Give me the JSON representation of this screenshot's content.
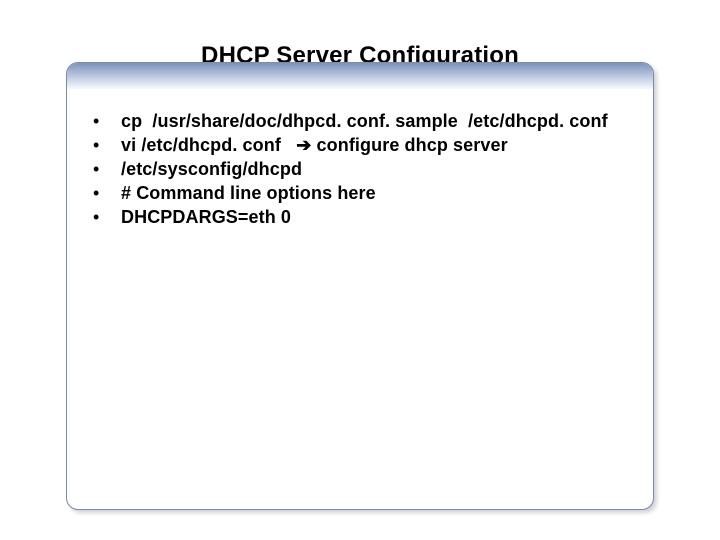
{
  "title": "DHCP Server Configuration",
  "bullet_char": "•",
  "arrow": "➔",
  "items": [
    {
      "text": "cp  /usr/share/doc/dhpcd. conf. sample  /etc/dhcpd. conf"
    },
    {
      "text_before": "vi /etc/dhcpd. conf   ",
      "uses_arrow": true,
      "text_after": " configure dhcp server"
    },
    {
      "text": "/etc/sysconfig/dhcpd"
    },
    {
      "text": "# Command line options here"
    },
    {
      "text": "DHCPDARGS=eth 0"
    }
  ]
}
